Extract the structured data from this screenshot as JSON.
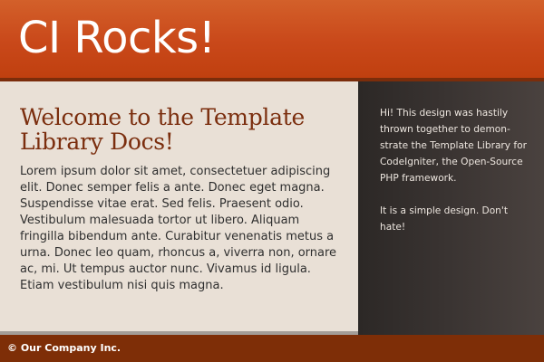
{
  "header": {
    "site_title": "CI Rocks!"
  },
  "main": {
    "heading": "Welcome to the Template Library Docs!",
    "body": "Lorem ipsum dolor sit amet, consectetuer adipiscing elit. Donec semper felis a ante. Donec eget magna. Suspendisse vitae erat. Sed felis. Praesent odio. Vestibulum malesuada tortor ut libero. Aliquam fringilla bibendum ante. Curabitur venenatis metus a urna. Donec leo quam, rhoncus a, viverra non, ornare ac, mi. Ut tempus auctor nunc. Vivamus id ligula. Etiam vestibulum nisi quis magna."
  },
  "sidebar": {
    "paragraphs": [
      "Hi! This design was hastily thrown together to demon-strate the Template Library for CodeIgniter, the Open-Source PHP framework.",
      "It is a simple design. Don't hate!"
    ]
  },
  "footer": {
    "copyright": "© Our Company Inc."
  },
  "colors": {
    "header_orange": "#c9481a",
    "heading_brown": "#7b2e0e",
    "content_background": "#e9e0d6",
    "sidebar_dark": "#393331",
    "footer_brown": "#7e2e07"
  }
}
